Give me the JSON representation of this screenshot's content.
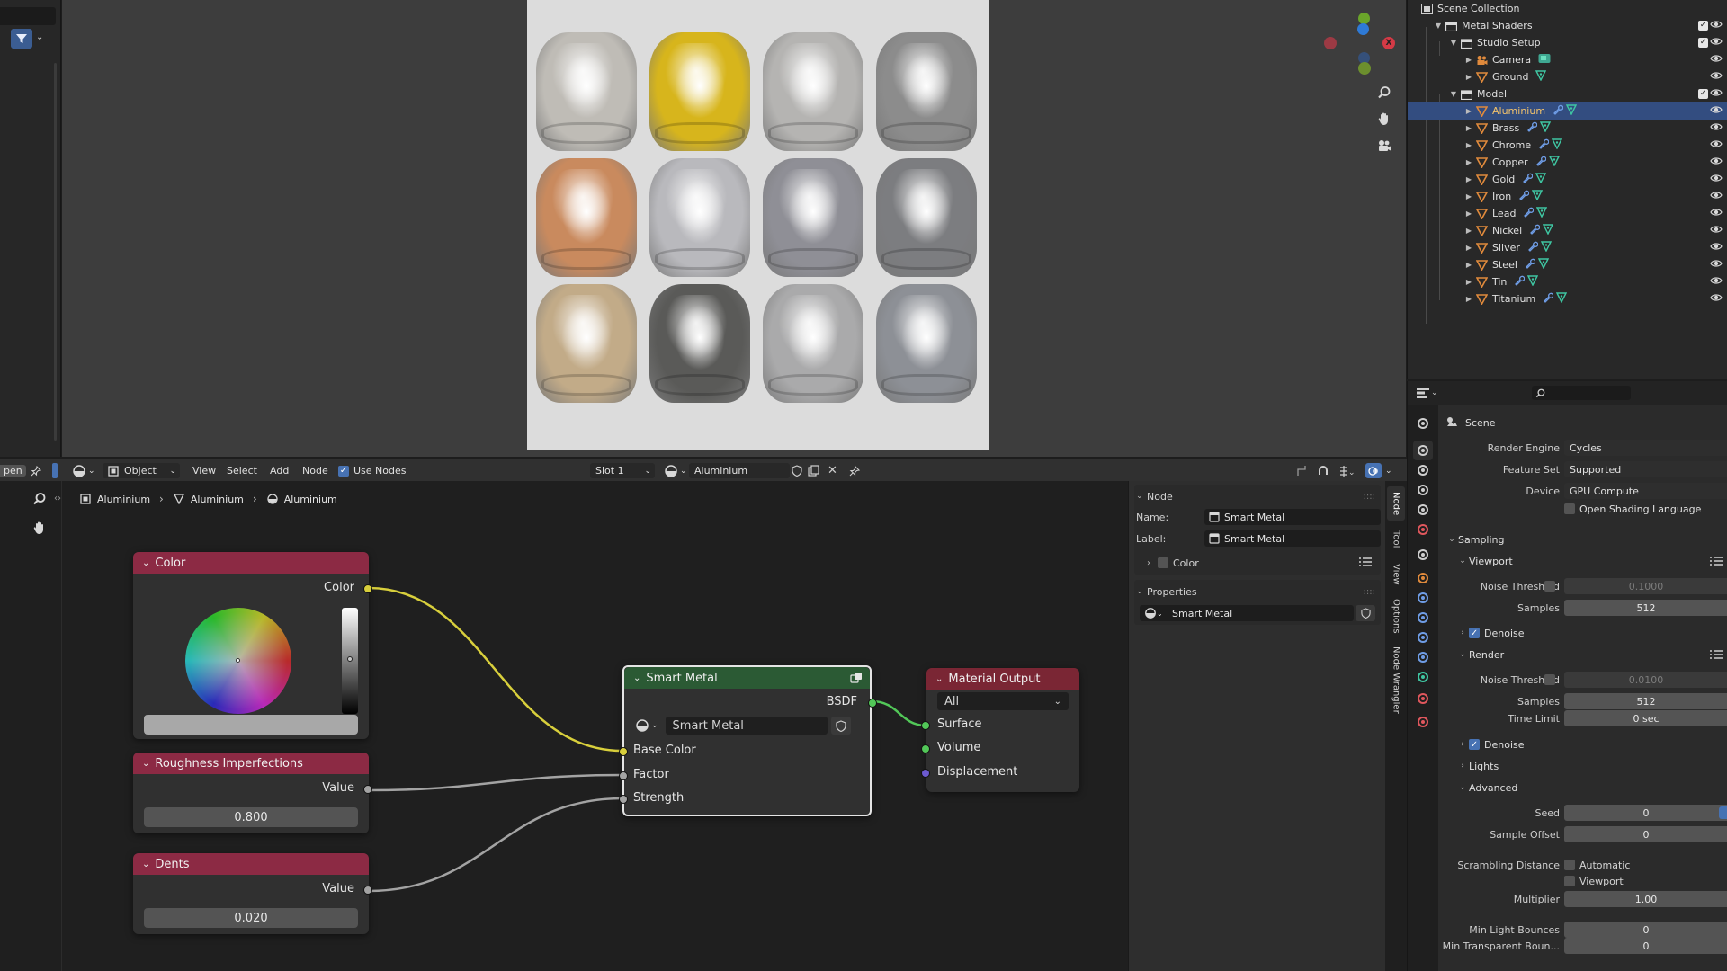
{
  "colors": {
    "accent": "#4772b3",
    "selection": "#334d80",
    "input_node_header": "#8c2a44",
    "group_node_header": "#2b5a34",
    "output_node_header": "#7a2634",
    "wire_color": "#d8cf3c",
    "wire_shader": "#52c758",
    "wire_value": "#a3a3a3"
  },
  "viewport": {
    "render_balls": [
      {
        "name": "aluminium",
        "color": "#bfbcb6"
      },
      {
        "name": "gold",
        "color": "#d7b51c"
      },
      {
        "name": "chrome",
        "color": "#b5b4b2"
      },
      {
        "name": "iron",
        "color": "#8c8c8c"
      },
      {
        "name": "copper",
        "color": "#c98a5e"
      },
      {
        "name": "nickel",
        "color": "#b9b9bd"
      },
      {
        "name": "lead",
        "color": "#8f8f96"
      },
      {
        "name": "steel",
        "color": "#7c7d80"
      },
      {
        "name": "brass",
        "color": "#c2ab88"
      },
      {
        "name": "tin",
        "color": "#5a5a58"
      },
      {
        "name": "silver",
        "color": "#aaaaab"
      },
      {
        "name": "titanium",
        "color": "#8d9096"
      }
    ]
  },
  "outliner": {
    "rows": [
      {
        "label": "Scene Collection",
        "icon": "scene-collection-icon",
        "depth": 0
      },
      {
        "label": "Metal Shaders",
        "icon": "collection-icon",
        "depth": 1,
        "checked": true
      },
      {
        "label": "Studio Setup",
        "icon": "collection-icon",
        "depth": 2,
        "checked": true
      },
      {
        "label": "Camera",
        "icon": "camera-object-icon",
        "depth": 3
      },
      {
        "label": "Ground",
        "icon": "mesh-object-icon",
        "depth": 3
      },
      {
        "label": "Model",
        "icon": "collection-icon",
        "depth": 2,
        "checked": true
      },
      {
        "label": "Aluminium",
        "icon": "mesh-object-icon",
        "depth": 3,
        "selected": true
      },
      {
        "label": "Brass",
        "icon": "mesh-object-icon",
        "depth": 3
      },
      {
        "label": "Chrome",
        "icon": "mesh-object-icon",
        "depth": 3
      },
      {
        "label": "Copper",
        "icon": "mesh-object-icon",
        "depth": 3
      },
      {
        "label": "Gold",
        "icon": "mesh-object-icon",
        "depth": 3
      },
      {
        "label": "Iron",
        "icon": "mesh-object-icon",
        "depth": 3
      },
      {
        "label": "Lead",
        "icon": "mesh-object-icon",
        "depth": 3
      },
      {
        "label": "Nickel",
        "icon": "mesh-object-icon",
        "depth": 3
      },
      {
        "label": "Silver",
        "icon": "mesh-object-icon",
        "depth": 3
      },
      {
        "label": "Steel",
        "icon": "mesh-object-icon",
        "depth": 3
      },
      {
        "label": "Tin",
        "icon": "mesh-object-icon",
        "depth": 3
      },
      {
        "label": "Titanium",
        "icon": "mesh-object-icon",
        "depth": 3
      }
    ]
  },
  "properties": {
    "search_placeholder": "",
    "scene_label": "Scene",
    "render_engine": {
      "label": "Render Engine",
      "value": "Cycles"
    },
    "feature_set": {
      "label": "Feature Set",
      "value": "Supported"
    },
    "device": {
      "label": "Device",
      "value": "GPU Compute"
    },
    "osl": "Open Shading Language",
    "sampling": "Sampling",
    "viewport": "Viewport",
    "vp_noise": {
      "label": "Noise Threshold",
      "value": "0.1000"
    },
    "vp_samples": {
      "label": "Samples",
      "value": "512"
    },
    "denoise": "Denoise",
    "render": "Render",
    "r_noise": {
      "label": "Noise Threshold",
      "value": "0.0100"
    },
    "r_samples": {
      "label": "Samples",
      "value": "512"
    },
    "time_limit": {
      "label": "Time Limit",
      "value": "0 sec"
    },
    "denoise2": "Denoise",
    "lights": "Lights",
    "advanced": "Advanced",
    "seed": {
      "label": "Seed",
      "value": "0"
    },
    "sample_offset": {
      "label": "Sample Offset",
      "value": "0"
    },
    "scrambling": {
      "label": "Scrambling Distance",
      "opt1": "Automatic",
      "opt2": "Viewport"
    },
    "multiplier": {
      "label": "Multiplier",
      "value": "1.00"
    },
    "min_light_bounces": {
      "label": "Min Light Bounces",
      "value": "0"
    },
    "min_transparent": {
      "label": "Min Transparent Boun...",
      "value": "0"
    }
  },
  "node_header": {
    "open_stub": "pen",
    "mode": "Object",
    "menus": [
      "View",
      "Select",
      "Add",
      "Node"
    ],
    "use_nodes": "Use Nodes",
    "slot": "Slot 1",
    "material": "Aluminium"
  },
  "breadcrumb": [
    "Aluminium",
    "Aluminium",
    "Aluminium"
  ],
  "nodes": {
    "color": {
      "title": "Color",
      "output": "Color"
    },
    "roughness": {
      "title": "Roughness Imperfections",
      "output": "Value",
      "value": "0.800"
    },
    "dents": {
      "title": "Dents",
      "output": "Value",
      "value": "0.020"
    },
    "smart_metal": {
      "title": "Smart Metal",
      "output": "BSDF",
      "group": "Smart Metal",
      "inputs": [
        "Base Color",
        "Factor",
        "Strength"
      ]
    },
    "material_output": {
      "title": "Material Output",
      "target": "All",
      "inputs": [
        "Surface",
        "Volume",
        "Displacement"
      ]
    }
  },
  "node_sidebar": {
    "node_section": "Node",
    "name_label": "Name:",
    "name_value": "Smart Metal",
    "label_label": "Label:",
    "label_value": "Smart Metal",
    "color_section": "Color",
    "properties_section": "Properties",
    "group_value": "Smart Metal",
    "tabs": [
      "Node",
      "Tool",
      "View",
      "Options",
      "Node Wrangler"
    ]
  }
}
